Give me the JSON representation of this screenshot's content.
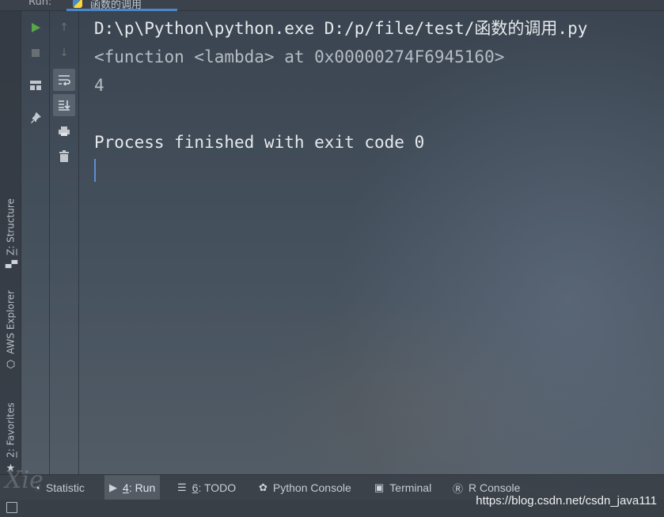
{
  "run_tab": {
    "label": "Run:",
    "file_name": "函数的调用"
  },
  "console": {
    "lines": [
      "D:\\p\\Python\\python.exe D:/p/file/test/函数的调用.py",
      "<function <lambda> at 0x00000274F6945160>",
      "4",
      "",
      "Process finished with exit code 0"
    ]
  },
  "left_tool_windows": [
    {
      "key": "Z",
      "rest": ": Structure",
      "icon": "structure-icon"
    },
    {
      "key": "",
      "rest": "AWS Explorer",
      "icon": "cube-icon"
    },
    {
      "key": "2",
      "rest": ": Favorites",
      "icon": "star-icon"
    }
  ],
  "bottom_tabs": [
    {
      "prefix": "",
      "key": "",
      "label": "Statistic",
      "icon": "statistic-icon"
    },
    {
      "prefix": "",
      "key": "4",
      "label": ": Run",
      "icon": "run-icon",
      "active": true
    },
    {
      "prefix": "",
      "key": "6",
      "label": ": TODO",
      "icon": "todo-icon"
    },
    {
      "prefix": "",
      "key": "",
      "label": "Python Console",
      "icon": "python-icon"
    },
    {
      "prefix": "",
      "key": "",
      "label": "Terminal",
      "icon": "terminal-icon"
    },
    {
      "prefix": "",
      "key": "",
      "label": "R Console",
      "icon": "r-icon"
    }
  ],
  "watermark": "https://blog.csdn.net/csdn_java111",
  "signature": "Xie",
  "colors": {
    "run_green": "#5aa54a",
    "caret_blue": "#5e8fd4",
    "tab_underline": "#4a88c7"
  }
}
